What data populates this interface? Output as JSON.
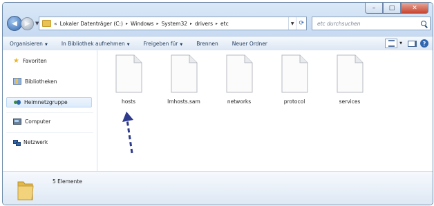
{
  "window": {
    "minimize_label": "–",
    "maximize_label": "□",
    "close_label": "✕"
  },
  "navigation": {
    "back_label": "◀",
    "forward_label": "▶",
    "history_dropdown_label": "▼"
  },
  "address_bar": {
    "chevron": "«",
    "crumbs": [
      "Lokaler Datenträger (C:)",
      "Windows",
      "System32",
      "drivers",
      "etc"
    ],
    "separator": "▸",
    "dropdown_label": "▼",
    "refresh_label": "⟳"
  },
  "search": {
    "placeholder": "etc durchsuchen"
  },
  "toolbar": {
    "organize_label": "Organisieren",
    "library_label": "In Bibliothek aufnehmen",
    "share_label": "Freigeben für",
    "burn_label": "Brennen",
    "new_folder_label": "Neuer Ordner",
    "dropdown_arrow": "▼",
    "help_label": "?"
  },
  "sidebar": {
    "items": [
      {
        "label": "Favoriten",
        "icon": "star-icon"
      },
      {
        "label": "Bibliotheken",
        "icon": "library-icon"
      },
      {
        "label": "Heimnetzgruppe",
        "icon": "homegroup-icon",
        "selected": true
      },
      {
        "label": "Computer",
        "icon": "computer-icon"
      },
      {
        "label": "Netzwerk",
        "icon": "network-icon"
      }
    ]
  },
  "files": [
    {
      "name": "hosts",
      "icon": "document-icon"
    },
    {
      "name": "lmhosts.sam",
      "icon": "document-icon"
    },
    {
      "name": "networks",
      "icon": "document-icon"
    },
    {
      "name": "protocol",
      "icon": "document-icon"
    },
    {
      "name": "services",
      "icon": "document-icon"
    }
  ],
  "status": {
    "count_text": "5 Elemente"
  },
  "colors": {
    "chrome_top": "#dbe9f8",
    "toolbar_text": "#1e395b",
    "annotation_arrow": "#2e3a8c",
    "close_button": "#c7452f"
  }
}
